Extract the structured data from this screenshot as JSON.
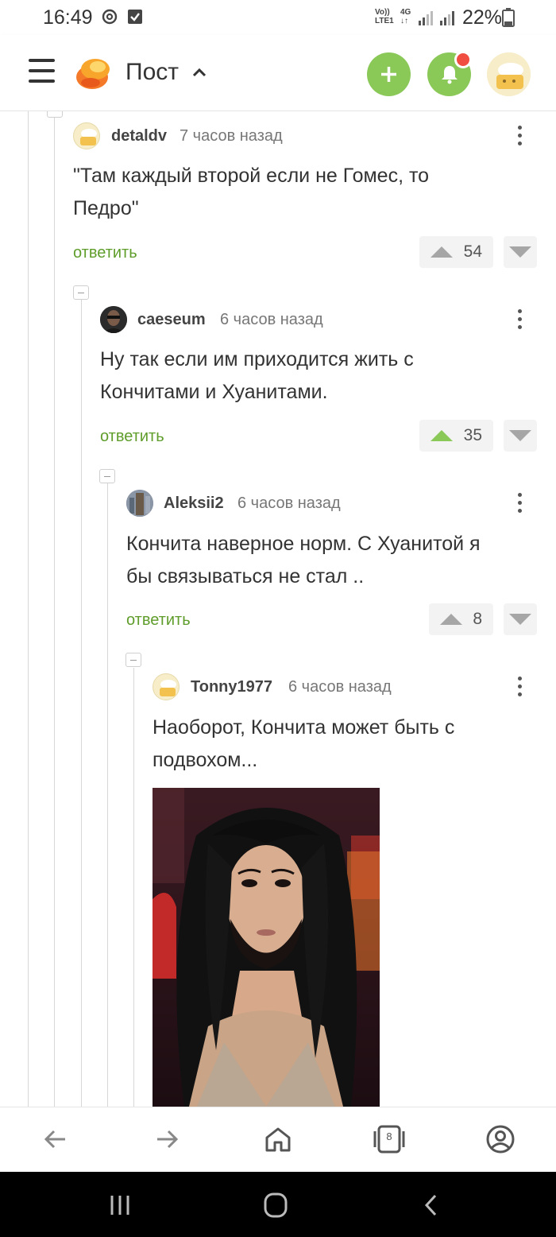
{
  "status_bar": {
    "time": "16:49",
    "network_line1": "Vo)) ",
    "network_line2": "LTE1",
    "gen": "4G",
    "battery": "22%"
  },
  "header": {
    "title": "Пост"
  },
  "comments": [
    {
      "author": "detaldv",
      "time": "7 часов назад",
      "text_line1": "\"Там каждый второй если не Гомес, то",
      "text_line2": "Педро\"",
      "reply": "ответить",
      "votes": "54",
      "upvoted": false
    },
    {
      "author": "caeseum",
      "time": "6 часов назад",
      "text_line1": "Ну так если им приходится жить с",
      "text_line2": "Кончитами и Хуанитами.",
      "reply": "ответить",
      "votes": "35",
      "upvoted": true
    },
    {
      "author": "Aleksii2",
      "time": "6 часов назад",
      "text_line1": "Кончита наверное норм. С Хуанитой я",
      "text_line2": "бы связываться не стал ..",
      "reply": "ответить",
      "votes": "8",
      "upvoted": false
    },
    {
      "author": "Tonny1977",
      "time": "6 часов назад",
      "text_line1": "Наоборот, Кончита может быть с",
      "text_line2": "подвохом..."
    }
  ],
  "browser_nav": {
    "tab_count": "8"
  },
  "icons": {
    "accent": "#8ac858",
    "notification": "#f04e41",
    "link": "#5f9d2b"
  }
}
